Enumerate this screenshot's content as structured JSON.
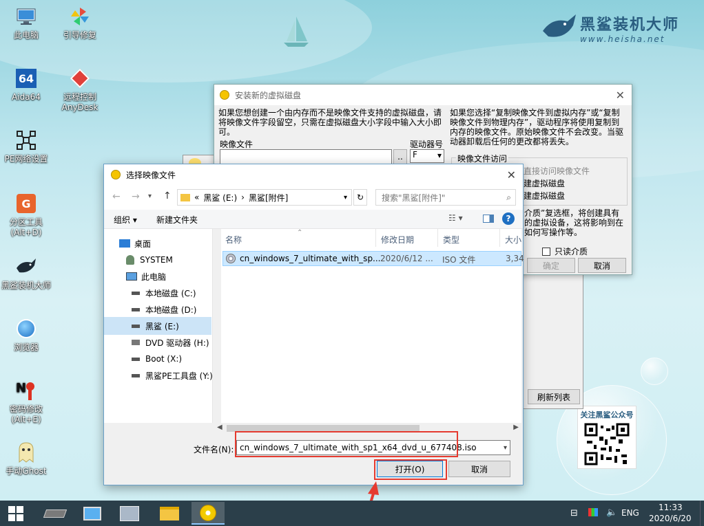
{
  "desktop": {
    "icons": [
      {
        "label": "此电脑",
        "icon": "computer-icon"
      },
      {
        "label": "引导修复",
        "icon": "pinwheel-icon"
      },
      {
        "label": "Aida64",
        "icon": "aida64-icon"
      },
      {
        "label": "远程控制 AnyDesk",
        "icon": "anydesk-icon"
      },
      {
        "label": "PE网络设置",
        "icon": "network-icon"
      },
      {
        "label": "分区工具 (Alt+D)",
        "icon": "partition-icon"
      },
      {
        "label": "黑鲨装机大师",
        "icon": "shark-icon"
      },
      {
        "label": "浏览器",
        "icon": "browser-icon"
      },
      {
        "label": "密码修改 (Alt+E)",
        "icon": "password-icon"
      },
      {
        "label": "手动Ghost",
        "icon": "ghost-icon"
      }
    ],
    "logo": {
      "title": "黑鲨装机大师",
      "url": "www.heisha.net"
    },
    "qr_caption": "关注黑鲨公众号"
  },
  "vd_window": {
    "title": "安装新的虚拟磁盘",
    "left_text": "如果您想创建一个由内存而不是映像文件支持的虚拟磁盘，请将映像文件字段留空，只需在虚拟磁盘大小字段中输入大小即可。",
    "right_text": "如果您选择“复制映像文件到虚拟内存”或“复制映像文件到物理内存”，驱动程序将使用复制到内存的映像文件。原始映像文件不会改变。当驱动器卸载后任何的更改都将丢失。",
    "image_file_label": "映像文件",
    "drive_label": "驱动器号",
    "drive_value": "F",
    "browse_label": "..",
    "access_group": "映像文件访问",
    "access_opt1": "直接访问映像文件",
    "access_opt2": "建虚拟磁盘",
    "access_opt3": "建虚拟磁盘",
    "media_text": "介质”复选框，将创建具有的虚拟设备，这将影响到在如何写操作等。",
    "readonly_label": "只读介质",
    "ok_label": "确定",
    "cancel_label": "取消",
    "refresh_label": "刷新列表"
  },
  "file_dialog": {
    "title": "选择映像文件",
    "breadcrumb_prefix": "«",
    "breadcrumb_1": "黑鲨 (E:)",
    "breadcrumb_sep": "›",
    "breadcrumb_2": "黑鲨[附件]",
    "search_placeholder": "搜索\"黑鲨[附件]\"",
    "organize_label": "组织 ▾",
    "new_folder_label": "新建文件夹",
    "nav_items": [
      {
        "label": "桌面",
        "icon": "desktop-icon"
      },
      {
        "label": "SYSTEM",
        "icon": "user-icon"
      },
      {
        "label": "此电脑",
        "icon": "computer-icon"
      },
      {
        "label": "本地磁盘 (C:)",
        "icon": "drive-icon"
      },
      {
        "label": "本地磁盘 (D:)",
        "icon": "drive-icon"
      },
      {
        "label": "黑鲨 (E:)",
        "icon": "drive-icon"
      },
      {
        "label": "DVD 驱动器 (H:)",
        "icon": "dvd-icon"
      },
      {
        "label": "Boot (X:)",
        "icon": "drive-icon"
      },
      {
        "label": "黑鲨PE工具盘 (Y:)",
        "icon": "drive-icon"
      }
    ],
    "columns": [
      "名称",
      "修改日期",
      "类型",
      "大小"
    ],
    "files": [
      {
        "name": "cn_windows_7_ultimate_with_sp...",
        "date": "2020/6/12 ...",
        "type": "ISO 文件",
        "size": "3,34"
      }
    ],
    "filename_label": "文件名(N):",
    "filename_value": "cn_windows_7_ultimate_with_sp1_x64_dvd_u_677408.iso",
    "open_label": "打开(O)",
    "cancel_label": "取消"
  },
  "taskbar": {
    "time": "11:33",
    "date": "2020/6/20",
    "lang": "ENG"
  }
}
